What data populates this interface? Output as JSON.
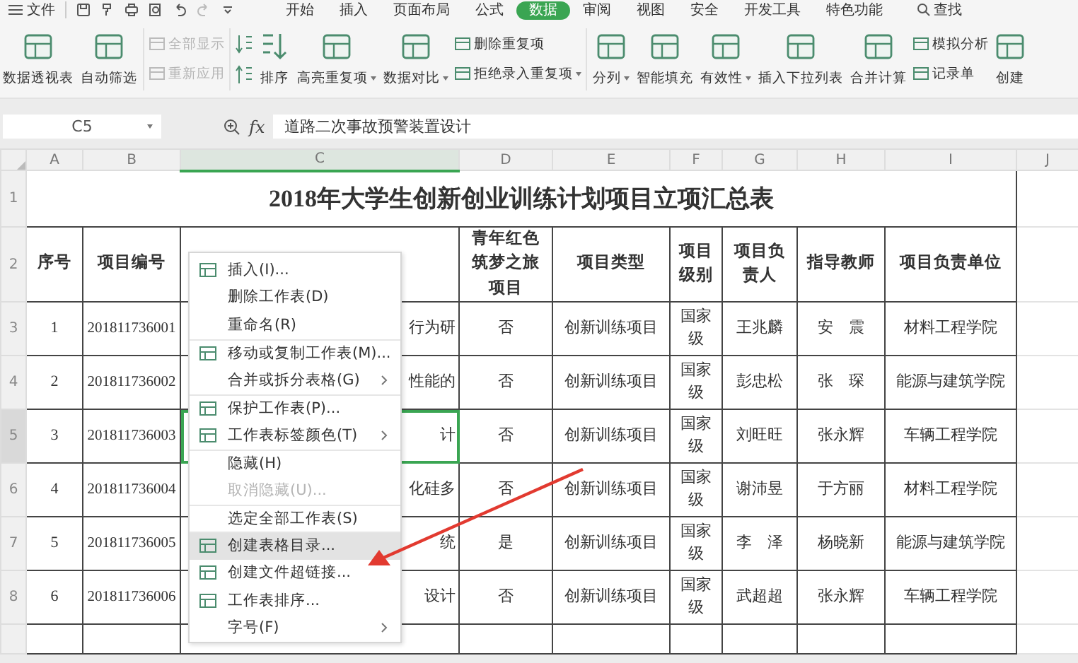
{
  "menu_bar": {
    "file": "文件",
    "tabs": [
      {
        "label": "开始",
        "selected": false
      },
      {
        "label": "插入",
        "selected": false
      },
      {
        "label": "页面布局",
        "selected": false
      },
      {
        "label": "公式",
        "selected": false
      },
      {
        "label": "数据",
        "selected": true
      },
      {
        "label": "审阅",
        "selected": false
      },
      {
        "label": "视图",
        "selected": false
      },
      {
        "label": "安全",
        "selected": false
      },
      {
        "label": "开发工具",
        "selected": false
      },
      {
        "label": "特色功能",
        "selected": false
      }
    ],
    "search": "查找"
  },
  "ribbon": [
    {
      "kind": "large",
      "label": "数据透视表",
      "dropdown": false
    },
    {
      "kind": "large",
      "label": "自动筛选",
      "dropdown": false
    },
    {
      "kind": "stack",
      "items": [
        {
          "label": "全部显示",
          "disabled": true,
          "dropdown": false
        },
        {
          "label": "重新应用",
          "disabled": true,
          "dropdown": false
        }
      ]
    },
    {
      "kind": "sort",
      "label": "排序",
      "dropdown": false
    },
    {
      "kind": "large",
      "label": "高亮重复项",
      "dropdown": true
    },
    {
      "kind": "large",
      "label": "数据对比",
      "dropdown": true
    },
    {
      "kind": "stack",
      "items": [
        {
          "label": "删除重复项",
          "disabled": false,
          "dropdown": false
        },
        {
          "label": "拒绝录入重复项",
          "disabled": false,
          "dropdown": true
        }
      ]
    },
    {
      "kind": "large",
      "label": "分列",
      "dropdown": true
    },
    {
      "kind": "large",
      "label": "智能填充",
      "dropdown": false
    },
    {
      "kind": "large",
      "label": "有效性",
      "dropdown": true
    },
    {
      "kind": "large",
      "label": "插入下拉列表",
      "dropdown": false
    },
    {
      "kind": "large",
      "label": "合并计算",
      "dropdown": false
    },
    {
      "kind": "stack",
      "items": [
        {
          "label": "模拟分析",
          "disabled": false,
          "dropdown": false
        },
        {
          "label": "记录单",
          "disabled": false,
          "dropdown": false
        }
      ]
    },
    {
      "kind": "large",
      "label": "创建",
      "dropdown": false
    }
  ],
  "formula_bar": {
    "cell_ref": "C5",
    "fx": "fx",
    "formula": "道路二次事故预警装置设计"
  },
  "sheet": {
    "columns": [
      {
        "label": "A",
        "selected": false
      },
      {
        "label": "B",
        "selected": false
      },
      {
        "label": "C",
        "selected": true
      },
      {
        "label": "D",
        "selected": false
      },
      {
        "label": "E",
        "selected": false
      },
      {
        "label": "F",
        "selected": false
      },
      {
        "label": "G",
        "selected": false
      },
      {
        "label": "H",
        "selected": false
      },
      {
        "label": "I",
        "selected": false
      },
      {
        "label": "J",
        "selected": false
      }
    ],
    "title_row": "1",
    "title": "2018年大学生创新创业训练计划项目立项汇总表",
    "header_row": "2",
    "headers_left": [
      "序号",
      "项目编号"
    ],
    "headers_right": [
      "青年红色筑梦之旅项目",
      "项目类型",
      "项目级别",
      "项目负责人",
      "指导教师",
      "项目负责单位"
    ],
    "rows": [
      {
        "row": "3",
        "selected": false,
        "cells": [
          "1",
          "201811736001",
          "行为研",
          "否",
          "创新训练项目",
          "国家级",
          "王兆麟",
          "安　震",
          "材料工程学院"
        ]
      },
      {
        "row": "4",
        "selected": false,
        "cells": [
          "2",
          "201811736002",
          "性能的",
          "否",
          "创新训练项目",
          "国家级",
          "彭忠松",
          "张　琛",
          "能源与建筑学院"
        ]
      },
      {
        "row": "5",
        "selected": true,
        "cells": [
          "3",
          "201811736003",
          "计",
          "否",
          "创新训练项目",
          "国家级",
          "刘旺旺",
          "张永辉",
          "车辆工程学院"
        ]
      },
      {
        "row": "6",
        "selected": false,
        "cells": [
          "4",
          "201811736004",
          "化硅多",
          "否",
          "创新训练项目",
          "国家级",
          "谢沛昱",
          "于方丽",
          "材料工程学院"
        ]
      },
      {
        "row": "7",
        "selected": false,
        "cells": [
          "5",
          "201811736005",
          "统",
          "是",
          "创新训练项目",
          "国家级",
          "李　泽",
          "杨晓新",
          "能源与建筑学院"
        ]
      },
      {
        "row": "8",
        "selected": false,
        "cells": [
          "6",
          "201811736006",
          "设计",
          "否",
          "创新训练项目",
          "国家级",
          "武超超",
          "张永辉",
          "车辆工程学院"
        ]
      }
    ]
  },
  "context_menu": [
    {
      "kind": "icon",
      "label": "插入(I)...",
      "submenu": false,
      "disabled": false,
      "selected": false,
      "separator_before": false
    },
    {
      "kind": "plain",
      "label": "删除工作表(D)",
      "submenu": false,
      "disabled": false,
      "selected": false,
      "separator_before": false
    },
    {
      "kind": "plain",
      "label": "重命名(R)",
      "submenu": false,
      "disabled": false,
      "selected": false,
      "separator_before": false
    },
    {
      "kind": "icon",
      "label": "移动或复制工作表(M)...",
      "submenu": false,
      "disabled": false,
      "selected": false,
      "separator_before": true
    },
    {
      "kind": "plain",
      "label": "合并或拆分表格(G)",
      "submenu": true,
      "disabled": false,
      "selected": false,
      "separator_before": false
    },
    {
      "kind": "icon",
      "label": "保护工作表(P)...",
      "submenu": false,
      "disabled": false,
      "selected": false,
      "separator_before": true
    },
    {
      "kind": "icon",
      "label": "工作表标签颜色(T)",
      "submenu": true,
      "disabled": false,
      "selected": false,
      "separator_before": false
    },
    {
      "kind": "plain",
      "label": "隐藏(H)",
      "submenu": false,
      "disabled": false,
      "selected": false,
      "separator_before": true
    },
    {
      "kind": "plain",
      "label": "取消隐藏(U)...",
      "submenu": false,
      "disabled": true,
      "selected": false,
      "separator_before": false
    },
    {
      "kind": "plain",
      "label": "选定全部工作表(S)",
      "submenu": false,
      "disabled": false,
      "selected": false,
      "separator_before": true
    },
    {
      "kind": "icon",
      "label": "创建表格目录...",
      "submenu": false,
      "disabled": false,
      "selected": true,
      "separator_before": true
    },
    {
      "kind": "icon",
      "label": "创建文件超链接...",
      "submenu": false,
      "disabled": false,
      "selected": false,
      "separator_before": false
    },
    {
      "kind": "icon",
      "label": "工作表排序...",
      "submenu": false,
      "disabled": false,
      "selected": false,
      "separator_before": false
    },
    {
      "kind": "plain",
      "label": "字号(F)",
      "submenu": true,
      "disabled": false,
      "selected": false,
      "separator_before": false
    }
  ]
}
